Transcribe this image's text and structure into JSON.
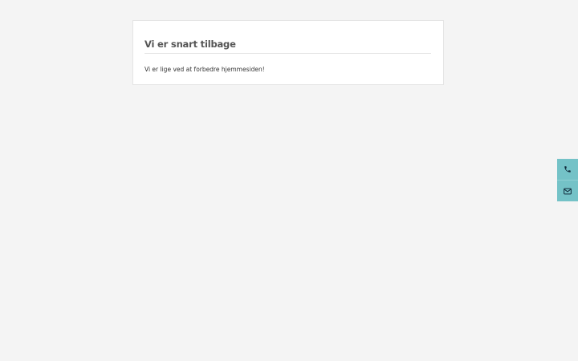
{
  "notice": {
    "title": "Vi er snart tilbage",
    "message": "Vi er lige ved at forbedre hjemmesiden!"
  },
  "contact_bar": {
    "buttons": [
      {
        "icon": "phone-icon"
      },
      {
        "icon": "envelope-icon"
      }
    ],
    "background_color": "#74c2c7",
    "icon_color": "#0f2a3a"
  },
  "page": {
    "background_color": "#f4f4f4"
  }
}
